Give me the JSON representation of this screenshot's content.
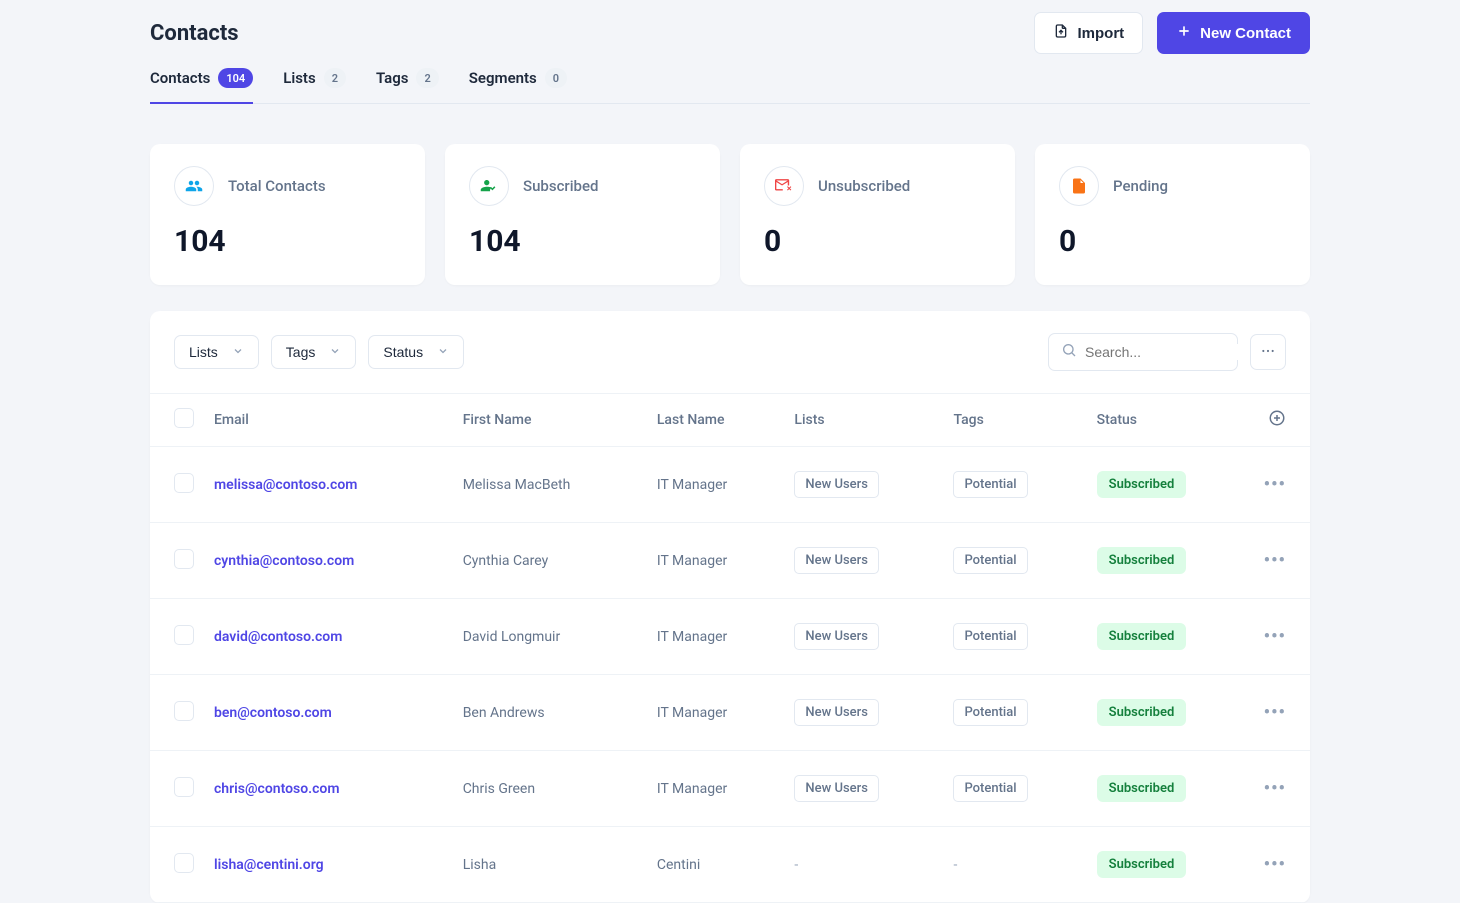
{
  "page": {
    "title": "Contacts"
  },
  "header_actions": {
    "import_label": "Import",
    "new_contact_label": "New Contact"
  },
  "tabs": [
    {
      "label": "Contacts",
      "count": "104",
      "active": true
    },
    {
      "label": "Lists",
      "count": "2",
      "active": false
    },
    {
      "label": "Tags",
      "count": "2",
      "active": false
    },
    {
      "label": "Segments",
      "count": "0",
      "active": false
    }
  ],
  "stats": [
    {
      "label": "Total Contacts",
      "value": "104",
      "icon": "users",
      "color": "#0ea5e9"
    },
    {
      "label": "Subscribed",
      "value": "104",
      "icon": "user-check",
      "color": "#16a34a"
    },
    {
      "label": "Unsubscribed",
      "value": "0",
      "icon": "mail-x",
      "color": "#ef4444"
    },
    {
      "label": "Pending",
      "value": "0",
      "icon": "file-clock",
      "color": "#f97316"
    }
  ],
  "filters": {
    "lists_label": "Lists",
    "tags_label": "Tags",
    "status_label": "Status"
  },
  "search": {
    "placeholder": "Search..."
  },
  "table": {
    "columns": {
      "email": "Email",
      "first_name": "First Name",
      "last_name": "Last Name",
      "lists": "Lists",
      "tags": "Tags",
      "status": "Status"
    },
    "rows": [
      {
        "email": "melissa@contoso.com",
        "first_name": "Melissa MacBeth",
        "last_name": "IT Manager",
        "list": "New Users",
        "tag": "Potential",
        "status": "Subscribed"
      },
      {
        "email": "cynthia@contoso.com",
        "first_name": "Cynthia Carey",
        "last_name": "IT Manager",
        "list": "New Users",
        "tag": "Potential",
        "status": "Subscribed"
      },
      {
        "email": "david@contoso.com",
        "first_name": "David Longmuir",
        "last_name": "IT Manager",
        "list": "New Users",
        "tag": "Potential",
        "status": "Subscribed"
      },
      {
        "email": "ben@contoso.com",
        "first_name": "Ben Andrews",
        "last_name": "IT Manager",
        "list": "New Users",
        "tag": "Potential",
        "status": "Subscribed"
      },
      {
        "email": "chris@contoso.com",
        "first_name": "Chris Green",
        "last_name": "IT Manager",
        "list": "New Users",
        "tag": "Potential",
        "status": "Subscribed"
      },
      {
        "email": "lisha@centini.org",
        "first_name": "Lisha",
        "last_name": "Centini",
        "list": "-",
        "tag": "-",
        "status": "Subscribed"
      }
    ]
  }
}
